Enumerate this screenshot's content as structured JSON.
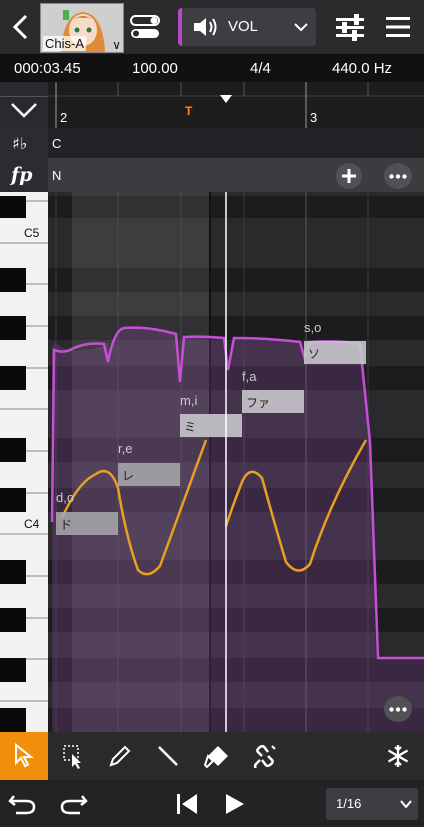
{
  "header": {
    "singer_name": "Chis-A",
    "track_label": "VOL",
    "colors": {
      "accent": "#b449c9",
      "pitch_curve": "#e8a020"
    }
  },
  "status": {
    "time": "000:03.45",
    "tempo": "100.00",
    "time_signature": "4/4",
    "frequency": "440.0 Hz"
  },
  "ruler": {
    "measures": [
      "2",
      "3"
    ],
    "tempo_marker": "T"
  },
  "tracks": {
    "chord_value": "C",
    "dynamics_value": "N"
  },
  "piano": {
    "labels": [
      "C5",
      "C4"
    ]
  },
  "notes": [
    {
      "phoneme": "d,o",
      "lyric": "ド"
    },
    {
      "phoneme": "r,e",
      "lyric": "レ"
    },
    {
      "phoneme": "m,i",
      "lyric": "ミ"
    },
    {
      "phoneme": "f,a",
      "lyric": "ファ"
    },
    {
      "phoneme": "s,o",
      "lyric": "ソ"
    }
  ],
  "transport": {
    "zoom_value": "1/16"
  },
  "icons": [
    "back-icon",
    "toggle-icon",
    "speaker-icon",
    "chevron-down-icon",
    "mixer-icon",
    "menu-icon",
    "collapse-icon",
    "sharp-flat-icon",
    "fp-icon",
    "plus-icon",
    "more-icon",
    "arrow-icon",
    "select-icon",
    "pen-icon",
    "line-icon",
    "eraser-icon",
    "link-icon",
    "snowflake-icon",
    "undo-icon",
    "redo-icon",
    "skip-back-icon",
    "play-icon"
  ]
}
